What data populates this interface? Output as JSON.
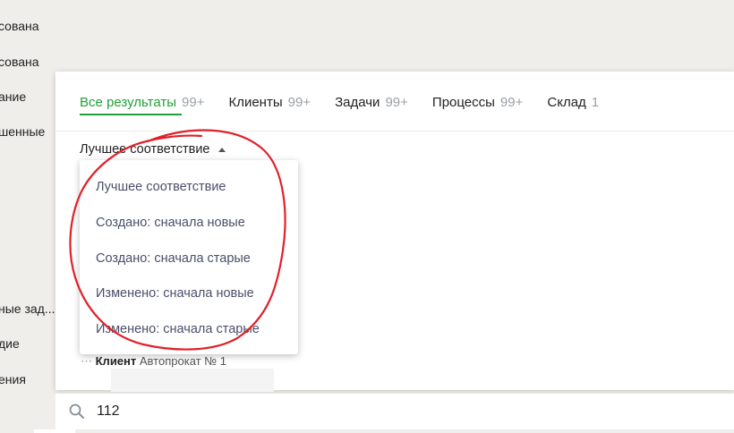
{
  "sidebar_items": [
    {
      "label": "сована",
      "note": "partially visible"
    },
    {
      "label": "сована"
    },
    {
      "label": "ание"
    },
    {
      "label": "шенные"
    },
    {
      "label": "ные зад..."
    },
    {
      "label": "дие"
    },
    {
      "label": "ения"
    }
  ],
  "tabs": [
    {
      "label": "Все результаты",
      "count": "99+",
      "active": true
    },
    {
      "label": "Клиенты",
      "count": "99+"
    },
    {
      "label": "Задачи",
      "count": "99+"
    },
    {
      "label": "Процессы",
      "count": "99+"
    },
    {
      "label": "Склад",
      "count": "1"
    }
  ],
  "sort": {
    "label": "Лучшее соответствие"
  },
  "dropdown": {
    "options": [
      "Лучшее соответствие",
      "Создано: сначала новые",
      "Создано: сначала старые",
      "Изменено: сначала новые",
      "Изменено: сначала старые"
    ]
  },
  "background": {
    "result_prefix": "Клиент",
    "result_text": "Автопрокат № 1"
  },
  "search": {
    "value": "112"
  },
  "colors": {
    "accent": "#21a038",
    "annotation": "#e0202a"
  }
}
